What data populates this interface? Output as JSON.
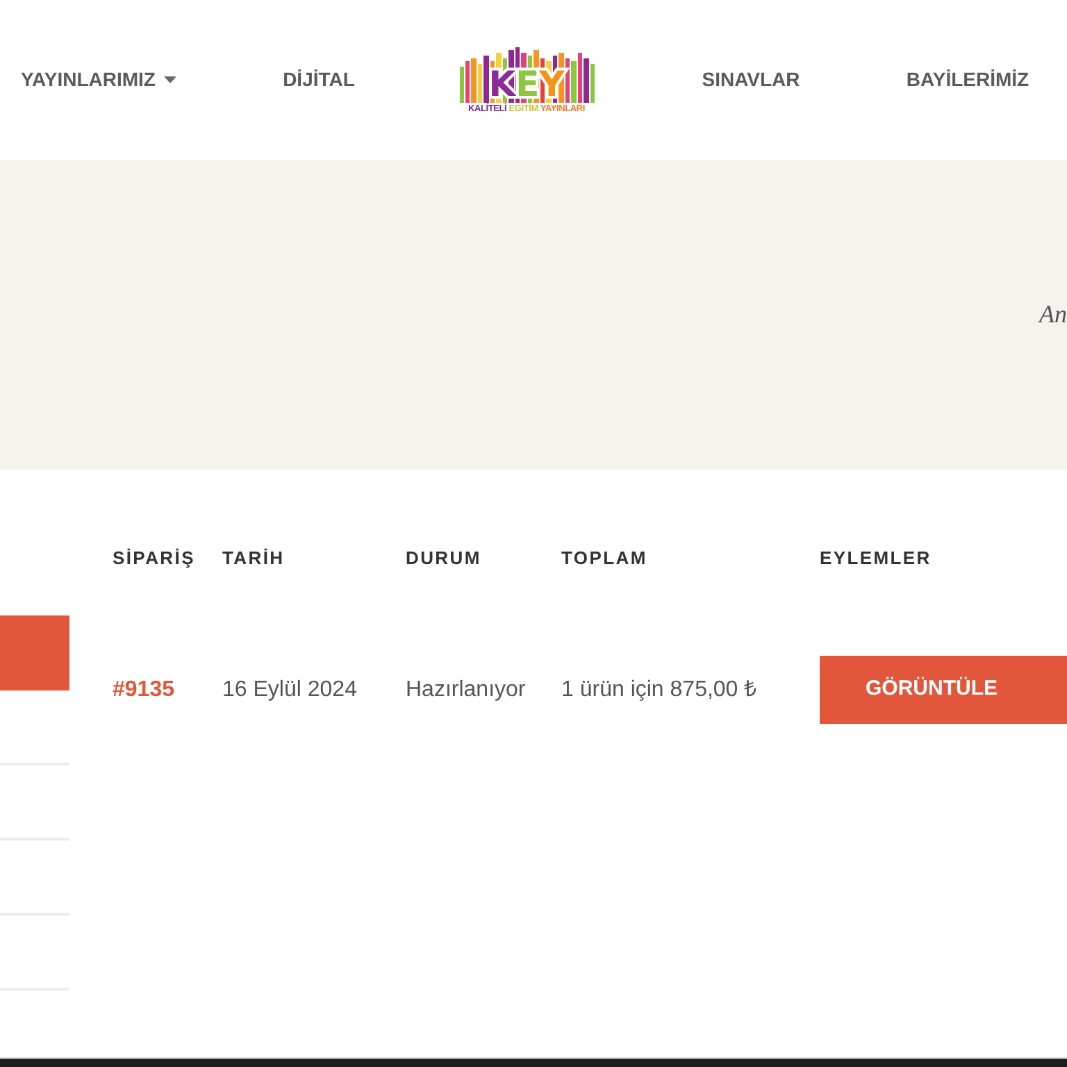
{
  "header": {
    "nav_left": [
      {
        "label": "YAYINLARIMIZ",
        "dropdown": true
      },
      {
        "label": "DİJİTAL",
        "dropdown": false
      }
    ],
    "logo": {
      "wordmark": "KEY",
      "tagline": [
        "KALİTELİ",
        "EĞİTİM",
        "YAYINLARI"
      ]
    },
    "nav_right": [
      {
        "label": "SINAVLAR",
        "dropdown": false
      },
      {
        "label": "BAYİLERİMİZ",
        "dropdown": false
      }
    ]
  },
  "hero": {
    "breadcrumb": "An"
  },
  "sidebar": {
    "items": [
      {
        "selected": true
      },
      {
        "selected": false
      },
      {
        "selected": false
      },
      {
        "selected": false
      },
      {
        "selected": false
      }
    ]
  },
  "orders_table": {
    "columns": [
      "SİPARİŞ",
      "TARİH",
      "DURUM",
      "TOPLAM",
      "EYLEMLER"
    ],
    "rows": [
      {
        "order": "#9135",
        "date": "16 Eylül 2024",
        "status": "Hazırlanıyor",
        "total": "1 ürün için 875,00 ₺",
        "action": "GÖRÜNTÜLE"
      }
    ]
  }
}
